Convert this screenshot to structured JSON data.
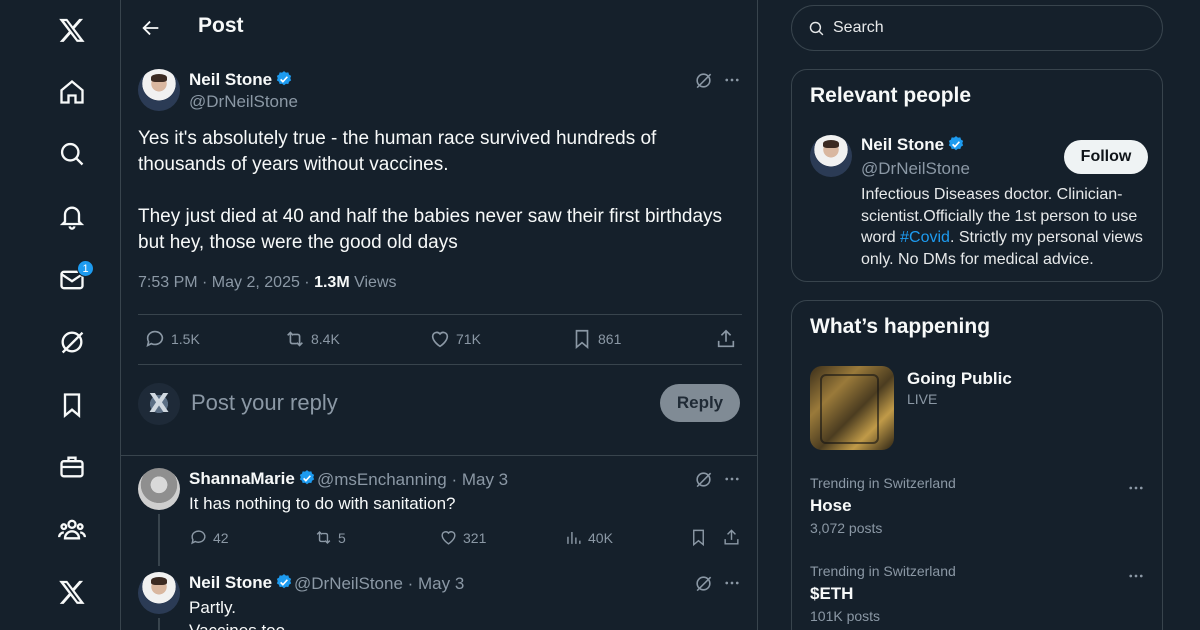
{
  "nav": {
    "items": [
      {
        "icon": "x-logo-icon"
      },
      {
        "icon": "home-icon"
      },
      {
        "icon": "search-icon"
      },
      {
        "icon": "bell-icon"
      },
      {
        "icon": "mail-icon",
        "badge": "1"
      },
      {
        "icon": "grok-icon"
      },
      {
        "icon": "bookmark-icon"
      },
      {
        "icon": "briefcase-icon"
      },
      {
        "icon": "communities-icon"
      },
      {
        "icon": "x-premium-icon"
      }
    ]
  },
  "header": {
    "title": "Post"
  },
  "post": {
    "author_name": "Neil Stone",
    "author_handle": "@DrNeilStone",
    "text_p1": "Yes it's absolutely true - the human race survived hundreds of thousands of years without vaccines.",
    "text_p2": "They just died at 40 and half the babies never saw their first birthdays but hey, those were the good old days",
    "time": "7:53 PM · May 2, 2025 · ",
    "views_count": "1.3M",
    "views_label": " Views",
    "replies": "1.5K",
    "reposts": "8.4K",
    "likes": "71K",
    "bookmarks": "861"
  },
  "composer": {
    "placeholder": "Post your reply",
    "reply_label": "Reply"
  },
  "replies": [
    {
      "name": "ShannaMarie",
      "handle_time": "@msEnchanning · May 3",
      "text": "It has nothing to do with sanitation?",
      "replies": "42",
      "reposts": "5",
      "likes": "321",
      "views": "40K"
    },
    {
      "name": "Neil Stone",
      "handle_time": "@DrNeilStone · May 3",
      "text_l1": "Partly.",
      "text_l2": "Vaccines too."
    }
  ],
  "search": {
    "placeholder": "Search"
  },
  "relevant": {
    "title": "Relevant people",
    "name": "Neil Stone",
    "handle": "@DrNeilStone",
    "follow_label": "Follow",
    "bio_pre": "Infectious Diseases doctor. Clinician-scientist.Officially the 1st person to use word ",
    "bio_tag": "#Covid",
    "bio_post": ". Strictly my personal views only. No DMs for medical advice."
  },
  "happening": {
    "title": "What’s happening",
    "featured": {
      "name": "Going Public",
      "status": "LIVE"
    },
    "trends": [
      {
        "category": "Trending in Switzerland",
        "name": "Hose",
        "count": "3,072 posts"
      },
      {
        "category": "Trending in Switzerland",
        "name": "$ETH",
        "count": "101K posts"
      }
    ]
  },
  "colors": {
    "background": "#15202b",
    "accent": "#1d9bf0",
    "border": "#38444d",
    "muted": "#8b98a5"
  }
}
